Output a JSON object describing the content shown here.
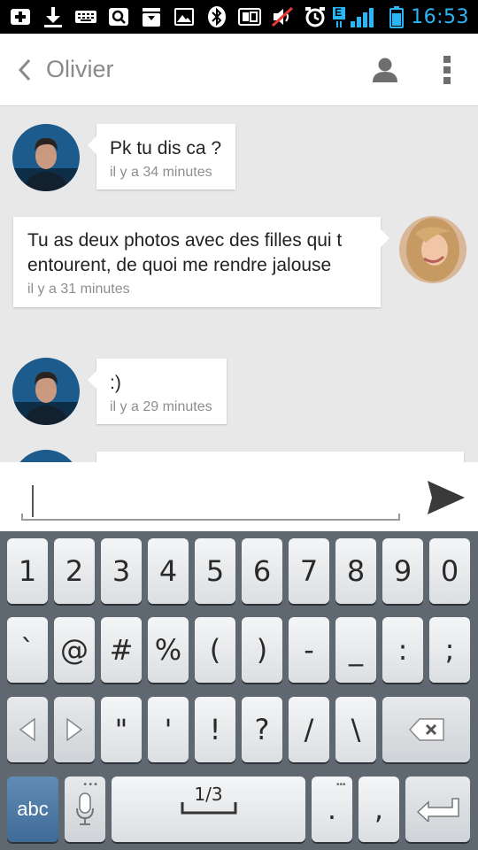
{
  "status_bar": {
    "time": "16:53",
    "network_badge": "E",
    "icons": [
      "plus-icon",
      "download-icon",
      "keyboard-icon",
      "search-icon",
      "inbox-icon",
      "image-icon",
      "bluetooth-icon",
      "nfc-icon",
      "mute-icon",
      "alarm-icon",
      "signal-icon",
      "battery-icon"
    ]
  },
  "header": {
    "title": "Olivier",
    "icons": [
      "back-chevron-icon",
      "person-icon",
      "overflow-menu-icon"
    ]
  },
  "messages": [
    {
      "sender": "Olivier",
      "side": "left",
      "text": "Pk tu dis ca ?",
      "time": "il y a 34 minutes"
    },
    {
      "sender": "me",
      "side": "right",
      "text": "Tu as deux photos avec des filles qui t entourent, de quoi me rendre jalouse",
      "time": "il y a 31 minutes"
    },
    {
      "sender": "Olivier",
      "side": "left",
      "text": ":)",
      "time": "il y a 29 minutes"
    },
    {
      "sender": "Olivier",
      "side": "left",
      "text": "",
      "time": ""
    }
  ],
  "compose": {
    "value": "",
    "placeholder": "",
    "send_icon": "send-icon"
  },
  "keyboard": {
    "row1": [
      "1",
      "2",
      "3",
      "4",
      "5",
      "6",
      "7",
      "8",
      "9",
      "0"
    ],
    "row2": [
      "`",
      "@",
      "#",
      "%",
      "(",
      ")",
      "-",
      "_",
      ":",
      ";"
    ],
    "row3": [
      "\"",
      "'",
      "!",
      "?",
      "/",
      "\\"
    ],
    "row3_icons": [
      "arrow-left-icon",
      "arrow-right-icon",
      "backspace-icon"
    ],
    "mode_key": "abc",
    "page_indicator": "1/3",
    "period": ".",
    "comma": ",",
    "icons": [
      "mic-icon",
      "space-bar-icon",
      "enter-icon"
    ]
  },
  "colors": {
    "clock": "#29b6f6",
    "signal": "#29b6f6",
    "mode_key": "#4a76a2",
    "keyboard_bg": "#5f6770"
  }
}
